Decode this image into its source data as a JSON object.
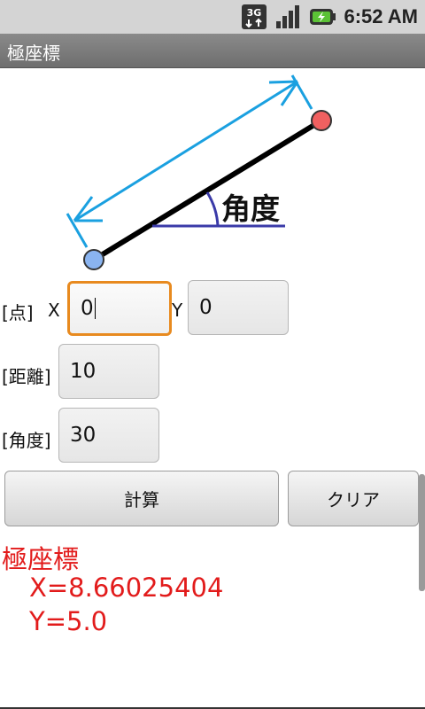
{
  "status": {
    "network": "3G",
    "time": "6:52 AM"
  },
  "app": {
    "title": "極座標"
  },
  "diagram": {
    "angle_label": "角度"
  },
  "form": {
    "point_label": "[点]",
    "x_label": "X",
    "x_value": "0",
    "y_label": "Y",
    "y_value": "0",
    "distance_label": "[距離]",
    "distance_value": "10",
    "angle_label": "[角度]",
    "angle_value": "30"
  },
  "buttons": {
    "calculate": "計算",
    "clear": "クリア"
  },
  "result": {
    "title": "極座標",
    "x": "X=8.66025404",
    "y": "Y=5.0"
  },
  "colors": {
    "result": "#e21b1b",
    "focus": "#e88a1f",
    "arrow": "#1aa0e0",
    "angle_line": "#3a3aa8"
  }
}
